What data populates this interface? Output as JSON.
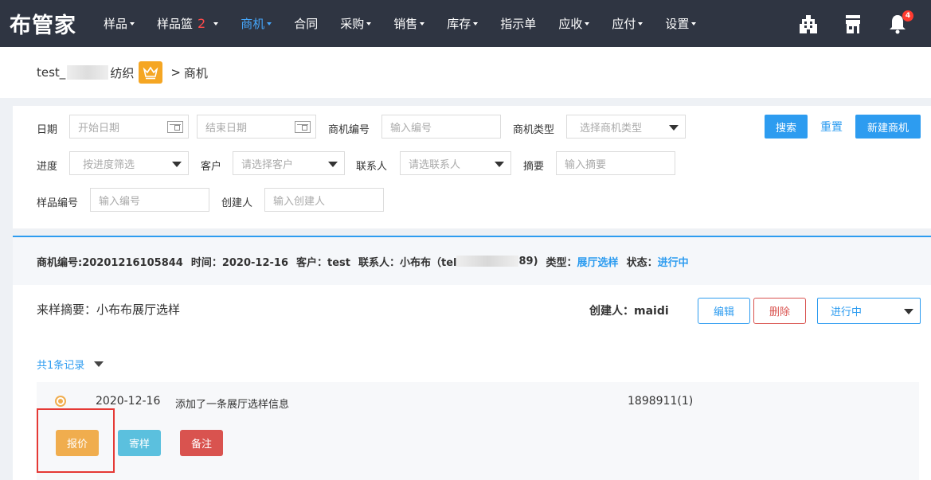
{
  "nav": {
    "logo": "布管家",
    "items": [
      {
        "label": "样品",
        "caret": true
      },
      {
        "label": "样品篮",
        "badge": "2",
        "caret": true
      },
      {
        "label": "商机",
        "caret": true,
        "active": true
      },
      {
        "label": "合同",
        "caret": false
      },
      {
        "label": "采购",
        "caret": true
      },
      {
        "label": "销售",
        "caret": true
      },
      {
        "label": "库存",
        "caret": true
      },
      {
        "label": "指示单",
        "caret": false
      },
      {
        "label": "应收",
        "caret": true
      },
      {
        "label": "应付",
        "caret": true
      },
      {
        "label": "设置",
        "caret": true
      }
    ],
    "icons": [
      "building-icon",
      "store-icon",
      "bell-icon"
    ],
    "notification_count": "4"
  },
  "breadcrumb": {
    "company_prefix": "test_",
    "company_suffix": "纺织",
    "separator": ">",
    "current": "商机"
  },
  "filters": {
    "date_label": "日期",
    "start_date_placeholder": "开始日期",
    "end_date_placeholder": "结束日期",
    "opportunity_no_label": "商机编号",
    "opportunity_no_placeholder": "输入编号",
    "opportunity_type_label": "商机类型",
    "opportunity_type_placeholder": "选择商机类型",
    "search_button": "搜索",
    "reset_button": "重置",
    "new_button": "新建商机",
    "progress_label": "进度",
    "progress_placeholder": "按进度筛选",
    "customer_label": "客户",
    "customer_placeholder": "请选择客户",
    "contact_label": "联系人",
    "contact_placeholder": "请选联系人",
    "summary_label": "摘要",
    "summary_placeholder": "输入摘要",
    "sample_no_label": "样品编号",
    "sample_no_placeholder": "输入编号",
    "creator_label": "创建人",
    "creator_placeholder": "输入创建人"
  },
  "record": {
    "opportunity_no": "商机编号:20201216105844",
    "time": "时间：2020-12-16",
    "customer": "客户：test",
    "contact_prefix": "联系人：小布布（tel",
    "contact_suffix": "89)",
    "type_label": "类型：",
    "type_value": "展厅选样",
    "status_label": "状态：",
    "status_value": "进行中",
    "summary": "来样摘要：小布布展厅选样",
    "creator": "创建人：maidi",
    "edit_button": "编辑",
    "delete_button": "删除",
    "status_select": "进行中",
    "count_text": "共1条记录",
    "entry": {
      "date": "2020-12-16",
      "text": "添加了一条展厅选样信息",
      "code": "1898911(1)"
    },
    "actions": {
      "quote": "报价",
      "send_sample": "寄样",
      "note": "备注"
    }
  },
  "colors": {
    "nav_bg": "#2f3542",
    "accent": "#2d9cf0",
    "quote": "#f0ad4e",
    "send_sample": "#5bc0de",
    "note": "#d9534f",
    "highlight": "#e53935"
  }
}
